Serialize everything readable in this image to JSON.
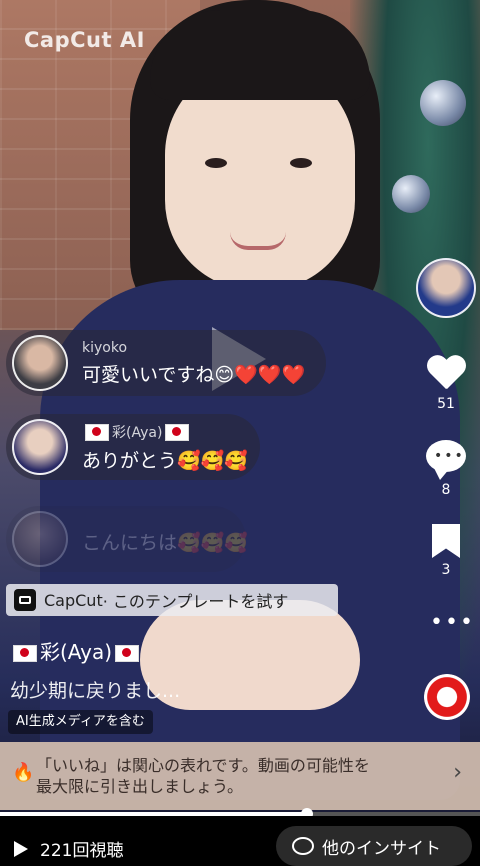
{
  "watermark": "CapCut AI",
  "side": {
    "likes": "51",
    "comments": "8",
    "saves": "3"
  },
  "comments": [
    {
      "name": "kiyoko",
      "message": "可愛いいですね😊❤️❤️❤️"
    },
    {
      "name": "彩(Aya)",
      "message": "ありがとう🥰🥰🥰"
    },
    {
      "name": "",
      "message": "こんにちは🥰🥰🥰"
    }
  ],
  "capcut": {
    "brand": "CapCut",
    "cta": " · このテンプレートを試す"
  },
  "post": {
    "username": "彩(Aya)",
    "description": "幼少期に戻りまし...",
    "ai_badge": "AI生成メディアを含む"
  },
  "tip": {
    "line1": "「いいね」は関心の表れです。動画の可能性を",
    "line2": "最大限に引き出しましょう。"
  },
  "progress_fraction": 0.64,
  "bottom": {
    "views": "221回視聴",
    "insight": "他のインサイト"
  },
  "colors": {
    "like": "#ffffff",
    "disc_accent": "#e21b1b"
  }
}
